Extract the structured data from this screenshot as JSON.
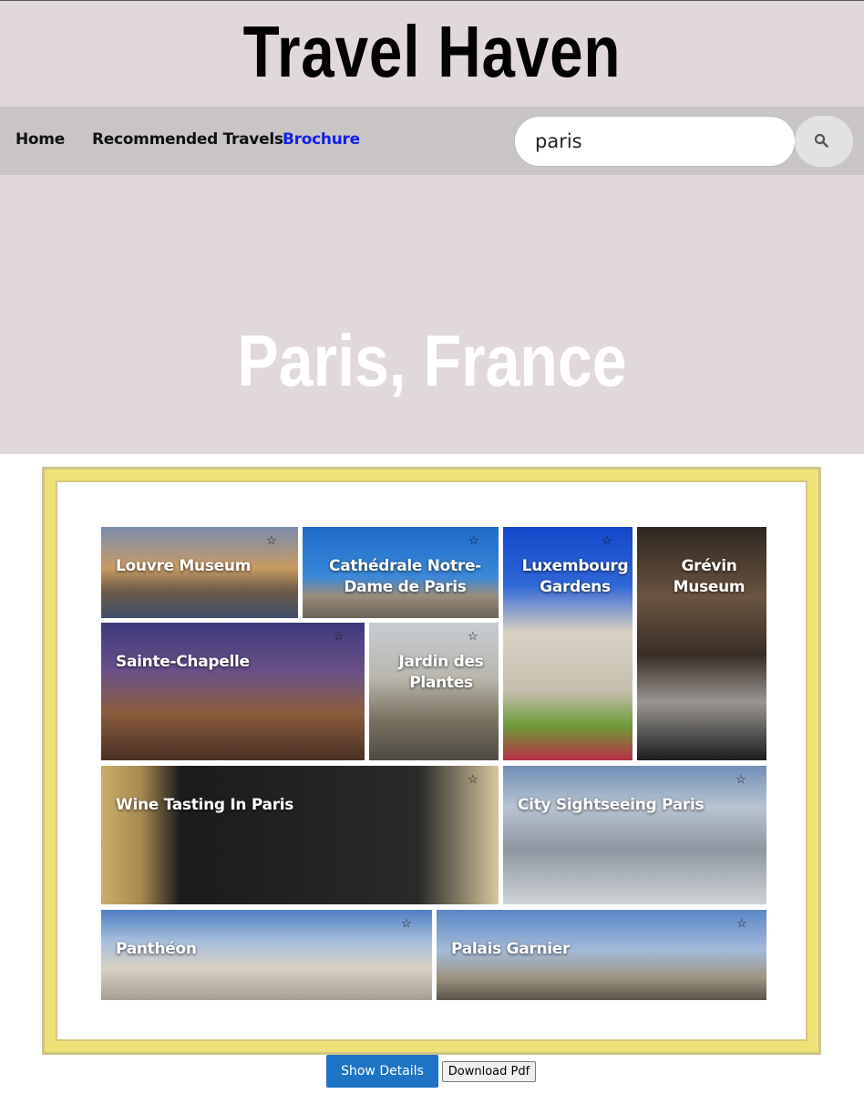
{
  "header": {
    "title": "Travel Haven"
  },
  "nav": {
    "home": "Home",
    "recommended": "Recommended Travels",
    "brochure": "Brochure",
    "active_color": "#1020e8"
  },
  "search": {
    "value": "paris",
    "icon": "search-icon"
  },
  "hero": {
    "title": "Paris, France"
  },
  "brochure": {
    "star_glyph": "☆",
    "tiles": [
      {
        "label": "Louvre Museum"
      },
      {
        "label": "Cathédrale Notre-Dame de Paris"
      },
      {
        "label": "Luxembourg Gardens"
      },
      {
        "label": "Grévin Museum"
      },
      {
        "label": "Sainte-Chapelle"
      },
      {
        "label": "Jardin des Plantes"
      },
      {
        "label": "Wine Tasting In Paris"
      },
      {
        "label": "City Sightseeing Paris"
      },
      {
        "label": "Panthéon"
      },
      {
        "label": "Palais Garnier"
      }
    ]
  },
  "actions": {
    "show_details": "Show Details",
    "download_pdf": "Download Pdf",
    "show_details_color": "#1f73c4"
  }
}
